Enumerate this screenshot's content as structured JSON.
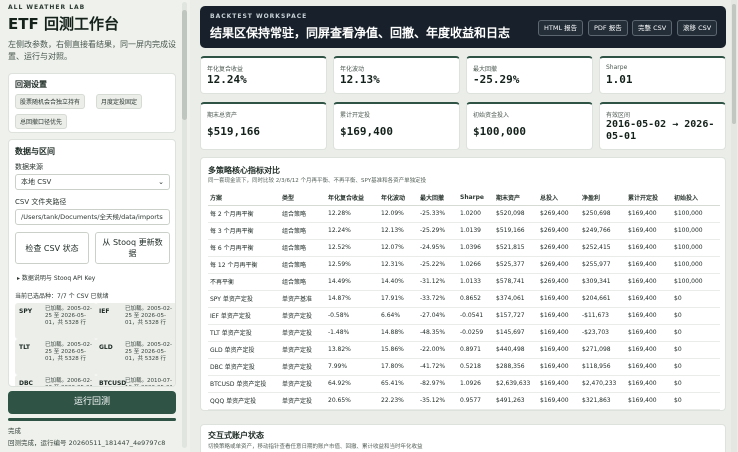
{
  "sidebar": {
    "brand": "ALL WEATHER LAB",
    "title": "ETF 回测工作台",
    "description": "左侧改参数，右侧直接看结果，同一屏内完成设置、运行与对照。",
    "settings": {
      "title": "回测设置",
      "chips": [
        "股票随机会合独立持有",
        "月度定投固定",
        "总回撤口径优先"
      ]
    },
    "data_source": {
      "title": "数据与区间",
      "source_label": "数据来源",
      "source_value": "本地 CSV",
      "path_label": "CSV 文件夹路径",
      "path_value": "/Users/tank/Documents/全天候/data/imports",
      "check_button": "检查 CSV 状态",
      "update_button": "从 Stooq 更新数据",
      "details_label": "▸  数据说明与 Stooq API Key",
      "selected_count": "当前已选品种：7/7 个 CSV 已就绪",
      "assets": [
        {
          "ticker": "SPY",
          "status": "已加载。2005-02-25 至 2026-05-01，共 5328 行"
        },
        {
          "ticker": "IEF",
          "status": "已加载。2005-02-25 至 2026-05-01，共 5328 行"
        },
        {
          "ticker": "TLT",
          "status": "已加载。2005-02-25 至 2026-05-01，共 5328 行"
        },
        {
          "ticker": "GLD",
          "status": "已加载。2005-02-25 至 2026-05-01，共 5328 行"
        },
        {
          "ticker": "DBC",
          "status": "已加载。2006-02-03 至 2026-05-01"
        },
        {
          "ticker": "BTCUSD",
          "status": "已加载。2010-07-19 至 2026-05-01"
        }
      ]
    },
    "run_button": "运行回测",
    "progress": 1.0,
    "status": "完成",
    "run_info": "回测完成，运行编号 20260511_181447_4e9797c8"
  },
  "hero": {
    "eyebrow": "BACKTEST WORKSPACE",
    "headline": "结果区保持常驻，同屏查看净值、回撤、年度收益和日志",
    "buttons": [
      "HTML 报告",
      "PDF 报告",
      "完整 CSV",
      "滚移 CSV"
    ]
  },
  "metrics": [
    {
      "label": "年化复合收益",
      "value": "12.24%"
    },
    {
      "label": "年化波动",
      "value": "12.13%"
    },
    {
      "label": "最大回撤",
      "value": "-25.29%"
    },
    {
      "label": "Sharpe",
      "value": "1.01"
    },
    {
      "label": "期末总资产",
      "value": "$519,166"
    },
    {
      "label": "累计开定投",
      "value": "$169,400"
    },
    {
      "label": "初始资金投入",
      "value": "$100,000"
    },
    {
      "label": "有效区间",
      "value": "2016-05-02 → 2026-05-01"
    }
  ],
  "comparison": {
    "title": "多策略核心指标对比",
    "subtitle": "同一套现金流下，同时比较 2/3/6/12 个月再平衡、不再平衡、SPY基准和各资产单独定投",
    "columns": [
      "方案",
      "类型",
      "年化复合收益",
      "年化波动",
      "最大回撤",
      "Sharpe",
      "期末资产",
      "总投入",
      "净盈利",
      "累计开定投",
      "初始投入"
    ],
    "rows": [
      [
        "每 2 个月再平衡",
        "组合策略",
        "12.28%",
        "12.09%",
        "-25.33%",
        "1.0200",
        "$520,098",
        "$269,400",
        "$250,698",
        "$169,400",
        "$100,000"
      ],
      [
        "每 3 个月再平衡",
        "组合策略",
        "12.24%",
        "12.13%",
        "-25.29%",
        "1.0139",
        "$519,166",
        "$269,400",
        "$249,766",
        "$169,400",
        "$100,000"
      ],
      [
        "每 6 个月再平衡",
        "组合策略",
        "12.52%",
        "12.07%",
        "-24.95%",
        "1.0396",
        "$521,815",
        "$269,400",
        "$252,415",
        "$169,400",
        "$100,000"
      ],
      [
        "每 12 个月再平衡",
        "组合策略",
        "12.59%",
        "12.31%",
        "-25.22%",
        "1.0266",
        "$525,377",
        "$269,400",
        "$255,977",
        "$169,400",
        "$100,000"
      ],
      [
        "不再平衡",
        "组合策略",
        "14.49%",
        "14.40%",
        "-31.12%",
        "1.0133",
        "$578,741",
        "$269,400",
        "$309,341",
        "$169,400",
        "$100,000"
      ],
      [
        "SPY 单资产定投",
        "单资产基准",
        "14.87%",
        "17.91%",
        "-33.72%",
        "0.8652",
        "$374,061",
        "$169,400",
        "$204,661",
        "$169,400",
        "$0"
      ],
      [
        "IEF 单资产定投",
        "单资产定投",
        "-0.58%",
        "6.64%",
        "-27.04%",
        "-0.0541",
        "$157,727",
        "$169,400",
        "-$11,673",
        "$169,400",
        "$0"
      ],
      [
        "TLT 单资产定投",
        "单资产定投",
        "-1.48%",
        "14.88%",
        "-48.35%",
        "-0.0259",
        "$145,697",
        "$169,400",
        "-$23,703",
        "$169,400",
        "$0"
      ],
      [
        "GLD 单资产定投",
        "单资产定投",
        "13.82%",
        "15.86%",
        "-22.00%",
        "0.8971",
        "$440,498",
        "$169,400",
        "$271,098",
        "$169,400",
        "$0"
      ],
      [
        "DBC 单资产定投",
        "单资产定投",
        "7.99%",
        "17.80%",
        "-41.72%",
        "0.5218",
        "$288,356",
        "$169,400",
        "$118,956",
        "$169,400",
        "$0"
      ],
      [
        "BTCUSD 单资产定投",
        "单资产定投",
        "64.92%",
        "65.41%",
        "-82.97%",
        "1.0926",
        "$2,639,633",
        "$169,400",
        "$2,470,233",
        "$169,400",
        "$0"
      ],
      [
        "QQQ 单资产定投",
        "单资产定投",
        "20.65%",
        "22.23%",
        "-35.12%",
        "0.9577",
        "$491,263",
        "$169,400",
        "$321,863",
        "$169,400",
        "$0"
      ]
    ]
  },
  "interactive": {
    "title": "交互式账户状态",
    "subtitle": "切换策略或单资产，移动指针查看任意日期的账户市值、回撤、累计收益和当时年化收益"
  },
  "colors": {
    "accent": "#2f5446",
    "hero_bg": "#18212b"
  }
}
